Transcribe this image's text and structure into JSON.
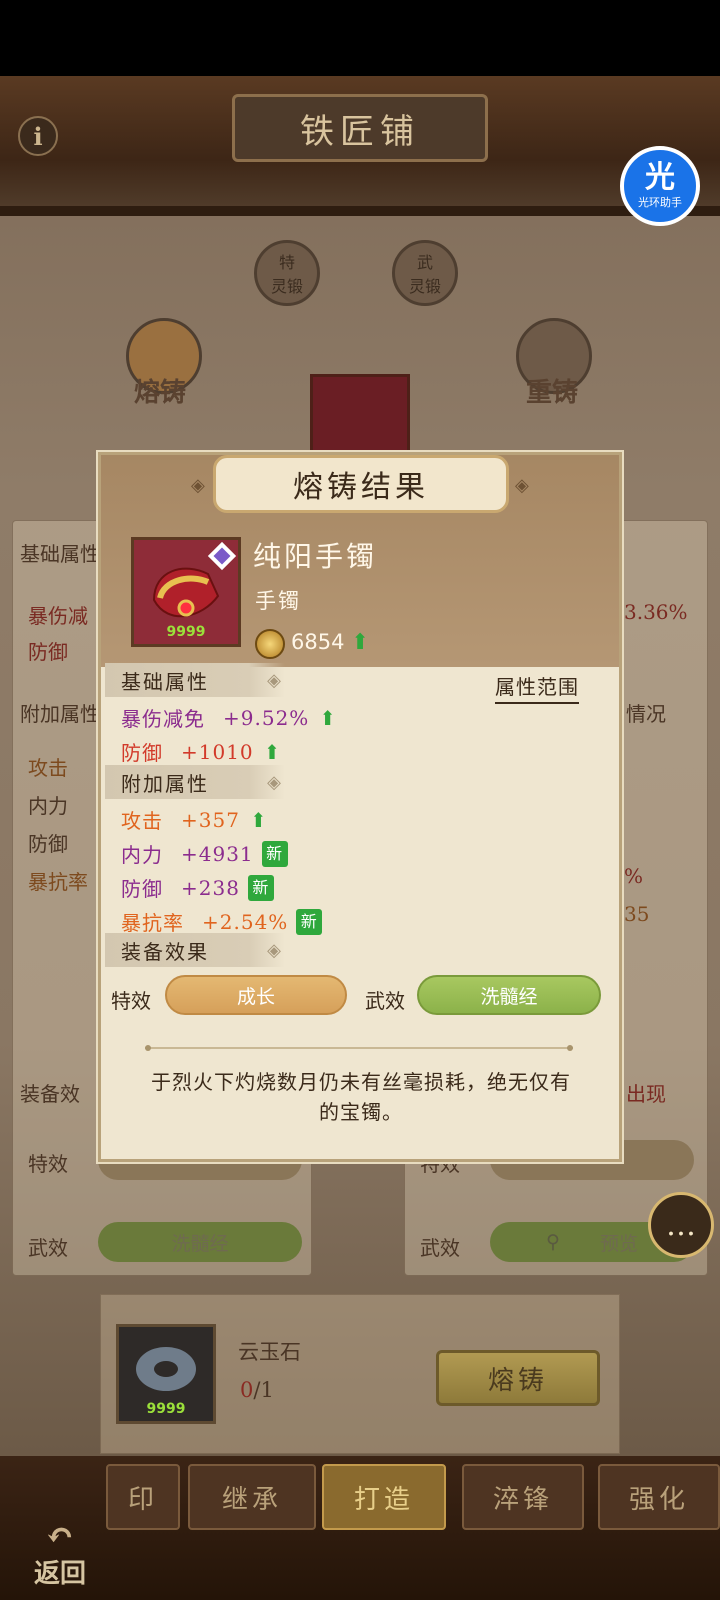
{
  "header": {
    "title": "铁匠铺",
    "info_icon": "i",
    "helper": {
      "logo": "光",
      "label": "光环助手"
    }
  },
  "modes": [
    {
      "label": "熔铸"
    },
    {
      "label": "重铸"
    },
    {
      "label": "特",
      "sub": "灵锻"
    },
    {
      "label": "武",
      "sub": "灵锻"
    }
  ],
  "background_panel": {
    "left_basic": "基础属性",
    "left_basic_attrs": [
      "暴伤减",
      "防御"
    ],
    "left_extra": "附加属性",
    "left_extra_attrs": [
      "攻击",
      "内力",
      "防御",
      "暴抗率"
    ],
    "right_frag_1": "3.36%",
    "right_frag_2": "情况",
    "right_frag_3": "%",
    "right_frag_4": "35",
    "equip_effect": "装备效",
    "right_effect": "出现",
    "special": "特效",
    "martial": "武效",
    "martial_value": "洗髓经",
    "preview": "预览",
    "right_special": "特效"
  },
  "material": {
    "name": "云玉石",
    "have": "0",
    "need": "/1",
    "qty": "9999",
    "button": "熔铸"
  },
  "bottom_nav": {
    "tabs": [
      "印",
      "继承",
      "打造",
      "淬锋",
      "强化"
    ],
    "back": "返回"
  },
  "modal": {
    "title": "熔铸结果",
    "item": {
      "name": "纯阳手镯",
      "type": "手镯",
      "power": "6854",
      "qty": "9999"
    },
    "basic_header": "基础属性",
    "range_link": "属性范围",
    "basic_attrs": [
      {
        "name": "暴伤减免",
        "value": "+9.52%",
        "color": "#8b2c8e",
        "tag": "up"
      },
      {
        "name": "防御",
        "value": "+1010",
        "color": "#d23a2a",
        "tag": "up"
      }
    ],
    "extra_header": "附加属性",
    "extra_attrs": [
      {
        "name": "攻击",
        "value": "+357",
        "color": "#e0641e",
        "tag": "up"
      },
      {
        "name": "内力",
        "value": "+4931",
        "color": "#8b2c8e",
        "tag": "新"
      },
      {
        "name": "防御",
        "value": "+238",
        "color": "#8b2c8e",
        "tag": "新"
      },
      {
        "name": "暴抗率",
        "value": "+2.54%",
        "color": "#e0641e",
        "tag": "新"
      }
    ],
    "effect_header": "装备效果",
    "special_label": "特效",
    "special_value": "成长",
    "martial_label": "武效",
    "martial_value": "洗髓经",
    "description": "于烈火下灼烧数月仍未有丝毫损耗，绝无仅有的宝镯。"
  },
  "colors": {
    "accent_gold": "#c9a870",
    "up_green": "#2fa83c",
    "purple": "#8b2c8e",
    "red": "#d23a2a",
    "orange": "#e0641e"
  }
}
